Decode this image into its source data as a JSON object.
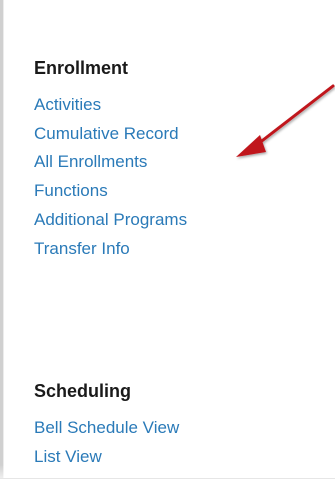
{
  "sections": [
    {
      "heading": "Enrollment",
      "links": [
        "Activities",
        "Cumulative Record",
        "All Enrollments",
        "Functions",
        "Additional Programs",
        "Transfer Info"
      ]
    },
    {
      "heading": "Scheduling",
      "links": [
        "Bell Schedule View",
        "List View"
      ]
    }
  ],
  "colors": {
    "link": "#2a7ab8",
    "heading": "#1a1a1a",
    "arrow": "#c0161c",
    "border": "#d0d0d0"
  },
  "annotation": {
    "icon": "red-arrow-icon",
    "points_to": "Cumulative Record"
  }
}
